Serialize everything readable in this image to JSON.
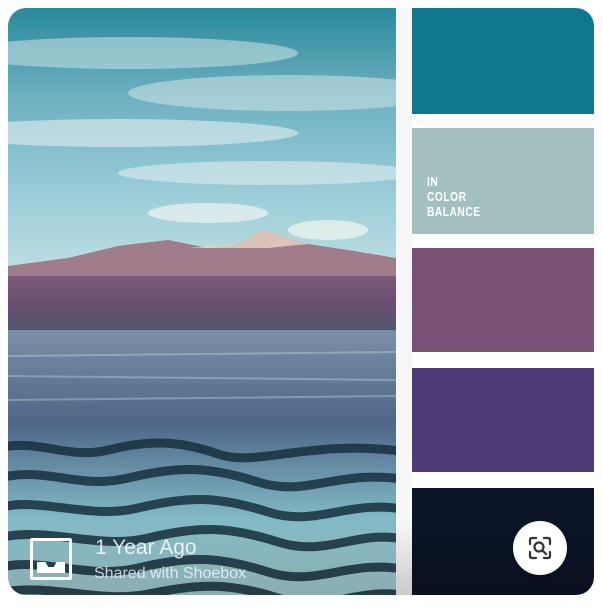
{
  "palette": {
    "brand_lines": [
      "IN",
      "COLOR",
      "BALANCE"
    ],
    "colors": [
      "#0f7890",
      "#a4bfc0",
      "#7a5278",
      "#4d3a77",
      "#0b1427"
    ]
  },
  "footer": {
    "time_label": "1 Year Ago",
    "shared_label": "Shared with Shoebox"
  },
  "icons": {
    "app": "shoebox-icon",
    "lens": "lens-search-icon"
  }
}
